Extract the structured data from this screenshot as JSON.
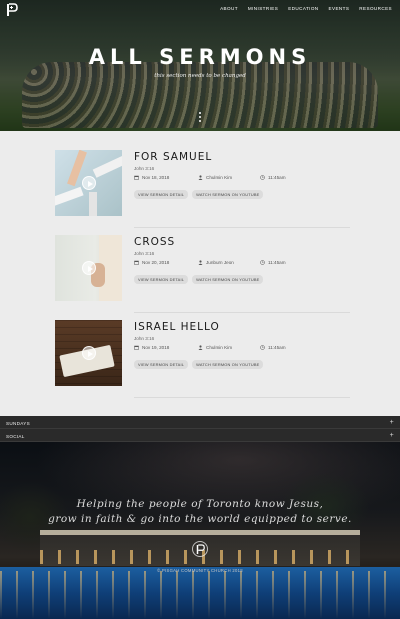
{
  "header": {
    "nav": [
      "ABOUT",
      "MINISTRIES",
      "EDUCATION",
      "EVENTS",
      "RESOURCES"
    ]
  },
  "hero": {
    "title": "ALL SERMONS",
    "subtitle": "this section needs to be changed"
  },
  "sermons": [
    {
      "title": "FOR SAMUEL",
      "verse": "John 3:16",
      "date": "Nov 18, 2018",
      "speaker": "Chulmin Kim",
      "time": "11:45am",
      "detail_label": "VIEW SERMON DETAIL",
      "youtube_label": "WATCH SERMON ON YOUTUBE"
    },
    {
      "title": "CROSS",
      "verse": "John 3:16",
      "date": "Nov 20, 2018",
      "speaker": "Junburn Jeon",
      "time": "11:45am",
      "detail_label": "VIEW SERMON DETAIL",
      "youtube_label": "WATCH SERMON ON YOUTUBE"
    },
    {
      "title": "ISRAEL HELLO",
      "verse": "John 3:16",
      "date": "Nov 19, 2018",
      "speaker": "Chulmin Kim",
      "time": "11:45am",
      "detail_label": "VIEW SERMON DETAIL",
      "youtube_label": "WATCH SERMON ON YOUTUBE"
    }
  ],
  "footer": {
    "sections": [
      "SUNDAYS",
      "SOCIAL"
    ],
    "expand_symbol": "+",
    "tagline_line1": "Helping the people of Toronto know Jesus,",
    "tagline_line2": "grow in faith & go into the world equipped to serve.",
    "copyright": "© PISGAH COMMUNITY CHURCH 2018"
  }
}
